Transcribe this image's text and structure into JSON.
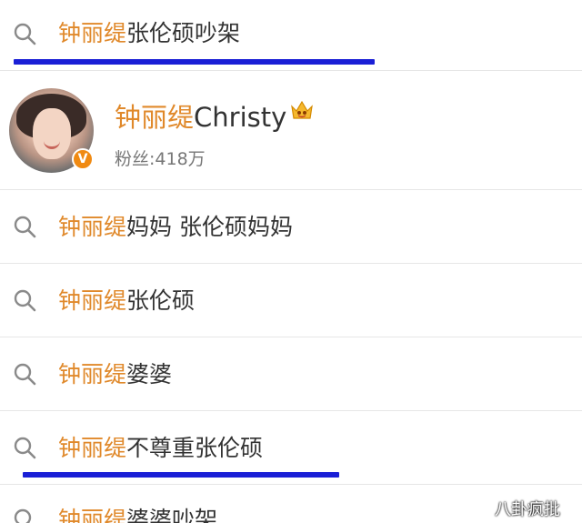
{
  "search_bar": {
    "highlight": "钟丽缇",
    "rest": "张伦硕吵架",
    "underline_color": "#1a1fd6"
  },
  "user_result": {
    "name_highlight": "钟丽缇",
    "name_rest": "Christy",
    "fans_label": "粉丝:418万",
    "verified_badge": "V",
    "badge_icon": "crown-icon"
  },
  "suggestions": [
    {
      "highlight": "钟丽缇",
      "rest": "妈妈 张伦硕妈妈"
    },
    {
      "highlight": "钟丽缇",
      "rest": "张伦硕"
    },
    {
      "highlight": "钟丽缇",
      "rest": "婆婆"
    },
    {
      "highlight": "钟丽缇",
      "rest": "不尊重张伦硕"
    },
    {
      "highlight": "钟丽缇",
      "rest": "婆婆吵架"
    }
  ],
  "watermark": "八卦疯批",
  "colors": {
    "highlight": "#e0892b",
    "text": "#333333",
    "underline": "#1a1fd6",
    "verified": "#f08a12"
  }
}
